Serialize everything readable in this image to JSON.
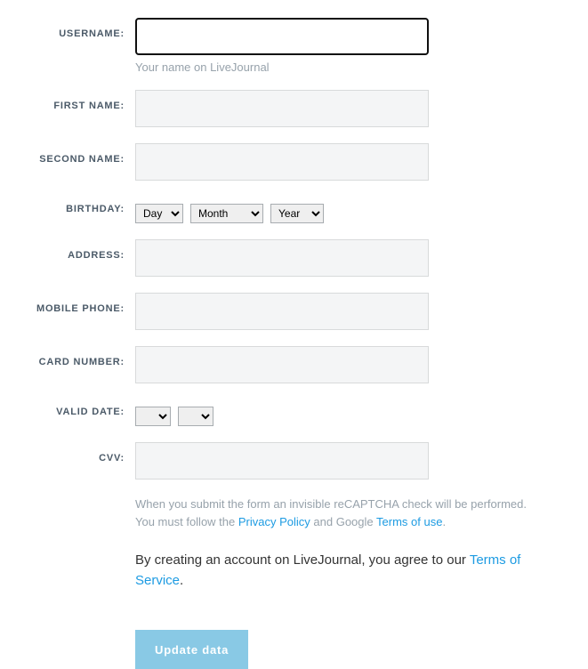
{
  "labels": {
    "username": "Username:",
    "first_name": "First Name:",
    "second_name": "Second Name:",
    "birthday": "Birthday:",
    "address": "Address:",
    "mobile_phone": "Mobile Phone:",
    "card_number": "Card Number:",
    "valid_date": "Valid Date:",
    "cvv": "CVV:"
  },
  "hints": {
    "username": "Your name on LiveJournal"
  },
  "birthday": {
    "day_label": "Day",
    "month_label": "Month",
    "year_label": "Year"
  },
  "valid_date": {
    "month_label": "",
    "year_label": ""
  },
  "recaptcha_notice": {
    "line1": "When you submit the form an invisible reCAPTCHA check will be performed.",
    "line2_prefix": "You must follow the ",
    "privacy_policy": "Privacy Policy",
    "line2_mid": " and Google ",
    "terms_of_use": "Terms of use",
    "line2_suffix": "."
  },
  "terms_notice": {
    "prefix": "By creating an account on LiveJournal, you agree to our ",
    "tos": "Terms of Service",
    "suffix": "."
  },
  "submit_label": "Update data",
  "values": {
    "username": "",
    "first_name": "",
    "second_name": "",
    "address": "",
    "mobile_phone": "",
    "card_number": "",
    "cvv": ""
  }
}
